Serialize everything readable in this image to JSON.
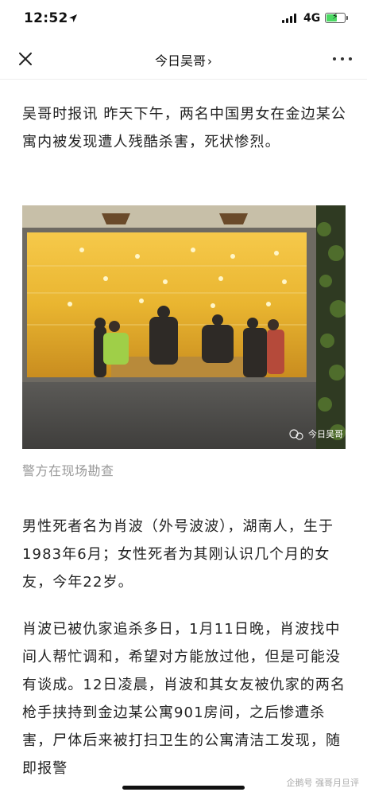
{
  "status_bar": {
    "time": "12:52",
    "network": "4G",
    "battery_level": 0.6,
    "icons": [
      "location-arrow-icon",
      "cellular-signal-icon",
      "battery-charging-icon"
    ]
  },
  "nav": {
    "title": "今日吴哥",
    "chevron": "›",
    "close_icon": "close-icon",
    "more_icon": "more-icon"
  },
  "article": {
    "para1": "吴哥时报讯 昨天下午，两名中国男女在金边某公寓内被发现遭人残酷杀害，死状惨烈。",
    "photo": {
      "watermark": "今日吴哥",
      "watermark_icon": "wechat-icon"
    },
    "caption": "警方在现场勘查",
    "para2": "男性死者名为肖波（外号波波），湖南人，生于1983年6月；女性死者为其刚认识几个月的女友，今年22岁。",
    "para3": "肖波已被仇家追杀多日，1月11日晚，肖波找中间人帮忙调和，希望对方能放过他，但是可能没有谈成。12日凌晨，肖波和其女友被仇家的两名枪手挟持到金边某公寓901房间，之后惨遭杀害，尸体后来被打扫卫生的公寓清洁工发现，随即报警"
  },
  "footer": {
    "watermark": "企鹅号 强哥月旦评"
  }
}
